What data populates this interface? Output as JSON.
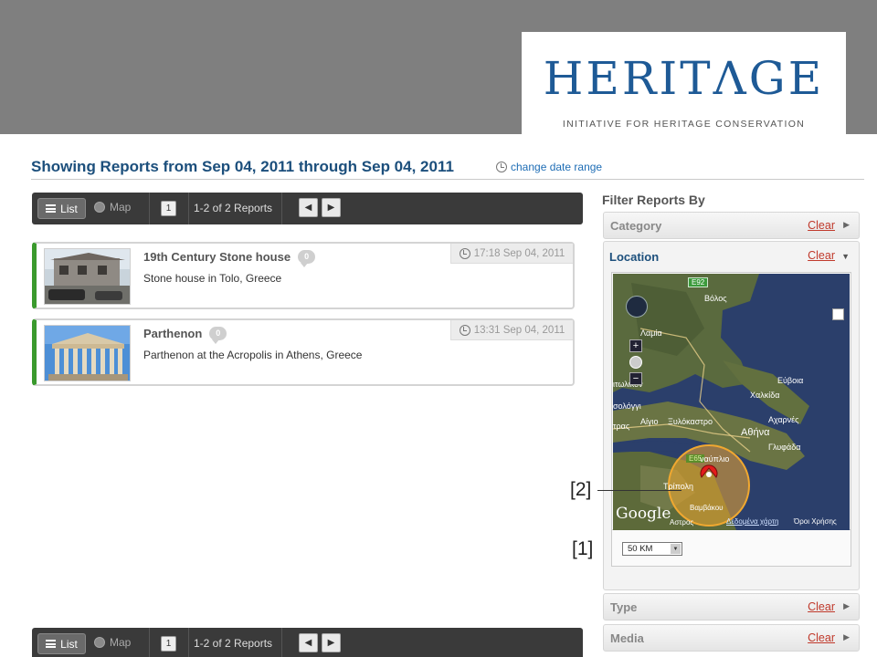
{
  "logo": {
    "name": "HERITΛGE",
    "tagline": "INITIATIVE FOR HERITAGE CONSERVATION",
    "color": "#1e5a96"
  },
  "header": {
    "title": "Showing Reports from Sep 04, 2011 through Sep 04, 2011",
    "change_range_label": "change date range"
  },
  "toolbar": {
    "list_label": "List",
    "map_label": "Map",
    "page": "1",
    "count_label": "1-2 of 2 Reports",
    "prev_icon": "chevron-left-icon",
    "next_icon": "chevron-right-icon",
    "prev_glyph": "◀",
    "next_glyph": "▶"
  },
  "reports": [
    {
      "title": "19th Century Stone house",
      "description": "Stone house in Tolo, Greece",
      "time": "17:18 Sep 04, 2011",
      "comments": "0"
    },
    {
      "title": "Parthenon",
      "description": "Parthenon at the Acropolis in Athens, Greece",
      "time": "13:31 Sep 04, 2011",
      "comments": "0"
    }
  ],
  "filters": {
    "title": "Filter Reports By",
    "clear_label": "Clear",
    "category_label": "Category",
    "location_label": "Location",
    "type_label": "Type",
    "media_label": "Media",
    "radius_value": "50 KM"
  },
  "map": {
    "road_e92": "E92",
    "road_e65": "E65",
    "town_volos": "Βόλος",
    "town_lamia": "Λαμία",
    "town_euboea": "Εύβοια",
    "town_chalkida": "Χαλκίδα",
    "town_acharnes": "Αχαρνές",
    "town_athens": "Αθήνα",
    "town_glyfada": "Γλυφάδα",
    "town_aigio": "Αίγιο",
    "town_xylokastro": "Ξυλόκαστρο",
    "town_patra": "τρας",
    "town_tripoli": "Τρίπολη",
    "town_nafplio": "ναύπλιο",
    "town_aitoliko": "ιτωλικόν",
    "town_mesolonghi": "σολόγγι",
    "town_vamvakou": "Βαμβάκου",
    "town_astros": "Αστρος",
    "google": "Google",
    "terms": "Όροι Χρήσης",
    "map_data": "Δεδομένα χάρτη",
    "zoom_in": "+",
    "zoom_out": "−",
    "radius_color": "#f0a830",
    "marker_color": "#e31b1b"
  },
  "callouts": {
    "marker": "[2]",
    "radius": "[1]"
  }
}
